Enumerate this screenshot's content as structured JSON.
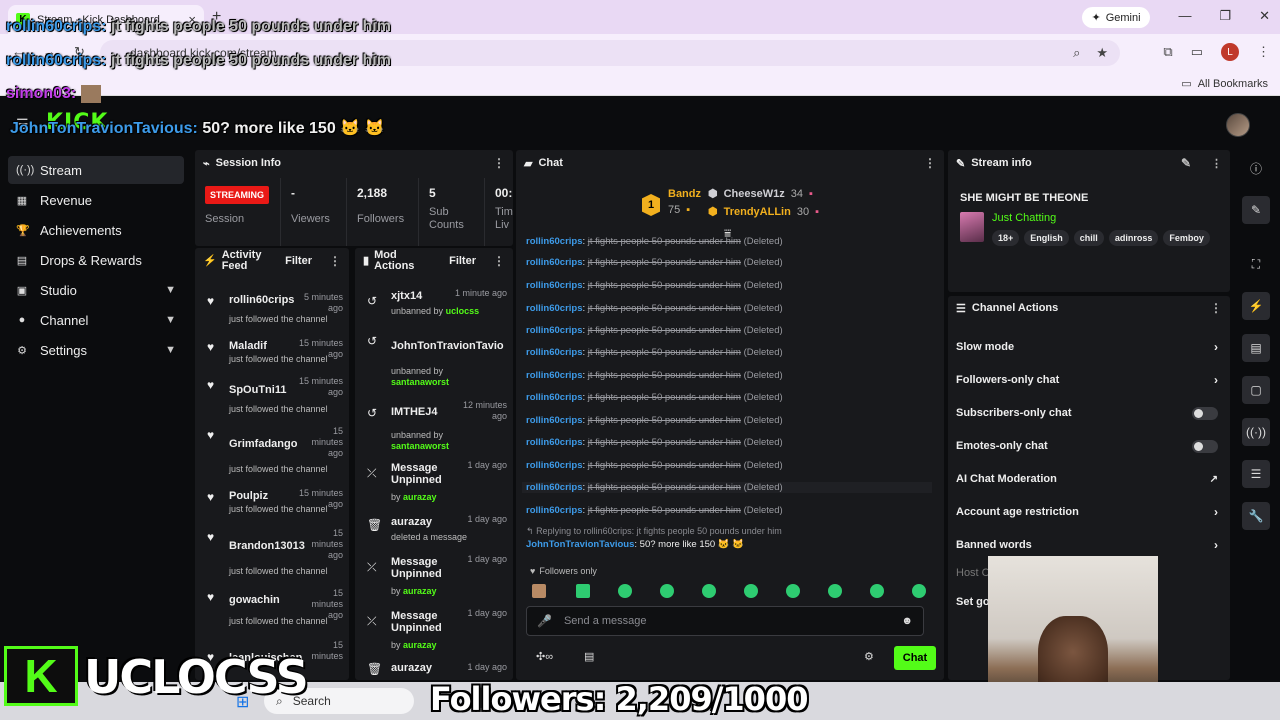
{
  "browser": {
    "tab_title": "Stream - Kick Dashboard",
    "url": "dashboard.kick.com/stream",
    "gemini_label": "Gemini",
    "all_bookmarks": "All Bookmarks",
    "profile_initial": "L"
  },
  "kick": {
    "logo_text": "KICK"
  },
  "nav": {
    "items": [
      {
        "label": "Stream",
        "icon": "broadcast-icon"
      },
      {
        "label": "Revenue",
        "icon": "bars-icon"
      },
      {
        "label": "Achievements",
        "icon": "trophy-icon"
      },
      {
        "label": "Drops & Rewards",
        "icon": "gift-icon"
      },
      {
        "label": "Studio",
        "icon": "studio-icon"
      },
      {
        "label": "Channel",
        "icon": "user-icon"
      },
      {
        "label": "Settings",
        "icon": "gear-icon"
      }
    ]
  },
  "session": {
    "title": "Session Info",
    "status": "STREAMING",
    "status_label": "Session",
    "viewers_value": "-",
    "viewers_label": "Viewers",
    "followers_value": "2,188",
    "followers_label": "Followers",
    "subs_value": "5",
    "subs_label": "Sub Counts",
    "time_value": "00:",
    "time_label": "Tim Liv"
  },
  "activity": {
    "title": "Activity Feed",
    "filter": "Filter",
    "items": [
      {
        "name": "rollin60crips",
        "time": "5 minutes ago",
        "sub": "just followed the channel"
      },
      {
        "name": "Maladif",
        "time": "15 minutes ago",
        "sub": "just followed the channel"
      },
      {
        "name": "SpOuTni11",
        "time": "15 minutes ago",
        "sub": "just followed the channel"
      },
      {
        "name": "Grimfadango",
        "time": "15 minutes ago",
        "sub": "just followed the channel"
      },
      {
        "name": "Poulpiz",
        "time": "15 minutes ago",
        "sub": "just followed the channel"
      },
      {
        "name": "Brandon13013",
        "time": "15 minutes ago",
        "sub": "just followed the channel"
      },
      {
        "name": "gowachin",
        "time": "15 minutes ago",
        "sub": "just followed the channel"
      },
      {
        "name": "leanlouischen",
        "time": "15 minutes",
        "sub": ""
      }
    ]
  },
  "mod": {
    "title": "Mod Actions",
    "filter": "Filter",
    "items": [
      {
        "name": "xjtx14",
        "time": "1 minute ago",
        "sub": "unbanned by",
        "by": "uclocss"
      },
      {
        "name": "JohnTonTravionTavio",
        "time": "",
        "sub": "unbanned by",
        "by": "santanaworst"
      },
      {
        "name": "IMTHEJ4",
        "time": "12 minutes ago",
        "sub": "unbanned by",
        "by": "santanaworst"
      },
      {
        "name": "Message Unpinned",
        "time": "1 day ago",
        "sub": "by",
        "by": "aurazay"
      },
      {
        "name": "aurazay",
        "time": "1 day ago",
        "sub": "deleted a message",
        "by": ""
      },
      {
        "name": "Message Unpinned",
        "time": "1 day ago",
        "sub": "by",
        "by": "aurazay"
      },
      {
        "name": "Message Unpinned",
        "time": "1 day ago",
        "sub": "by",
        "by": "aurazay"
      },
      {
        "name": "aurazay",
        "time": "1 day ago",
        "sub": "",
        "by": ""
      }
    ]
  },
  "chat": {
    "title": "Chat",
    "leaderboard": {
      "rank": "1",
      "first": {
        "name": "Bandz",
        "count": "75"
      },
      "second": {
        "name": "CheeseW1z",
        "count": "34"
      },
      "third": {
        "name": "TrendyALLin",
        "count": "30"
      }
    },
    "deleted_user": "rollin60crips",
    "deleted_text": "jt fights people 50 pounds under him",
    "deleted_tag": "(Deleted)",
    "reply_context": "Replying to rollin60crips: jt fights people 50 pounds under him",
    "last_user": "JohnTonTravionTavious",
    "last_msg": "50? more like 150 🐱 🐱",
    "followers_only": "Followers only",
    "input_placeholder": "Send a message",
    "send_label": "Chat"
  },
  "stream_info": {
    "title": "Stream info",
    "stream_title": "SHE MIGHT BE THEONE",
    "category": "Just Chatting",
    "tags": [
      "18+",
      "English",
      "chill",
      "adinross",
      "Femboy"
    ]
  },
  "channel_actions": {
    "title": "Channel Actions",
    "items": [
      {
        "label": "Slow mode",
        "control": "chevron"
      },
      {
        "label": "Followers-only chat",
        "control": "chevron"
      },
      {
        "label": "Subscribers-only chat",
        "control": "toggle"
      },
      {
        "label": "Emotes-only chat",
        "control": "toggle"
      },
      {
        "label": "AI Chat Moderation",
        "control": "external"
      },
      {
        "label": "Account age restriction",
        "control": "chevron"
      },
      {
        "label": "Banned words",
        "control": "chevron"
      },
      {
        "label": "Host C",
        "control": "none"
      },
      {
        "label": "Set go",
        "control": "none"
      }
    ]
  },
  "overlay": {
    "line1_user": "rollin60crips:",
    "line1_msg": "jt fights people 50 pounds under him",
    "line2_user": "rollin60crips:",
    "line2_msg": "jt fights people 50 pounds under him",
    "line3_user": "simon03:",
    "line4_user": "JohnTonTravionTavious:",
    "line4_msg": "50? more like 150 🐱 🐱",
    "brand": "UCLOCSS",
    "followers_goal": "Followers: 2,209/1000"
  },
  "taskbar": {
    "search_label": "Search"
  },
  "colors": {
    "kick_green": "#53fc18",
    "live_red": "#e91916",
    "chat_blue": "#3d9be9",
    "panel": "#18191c"
  }
}
